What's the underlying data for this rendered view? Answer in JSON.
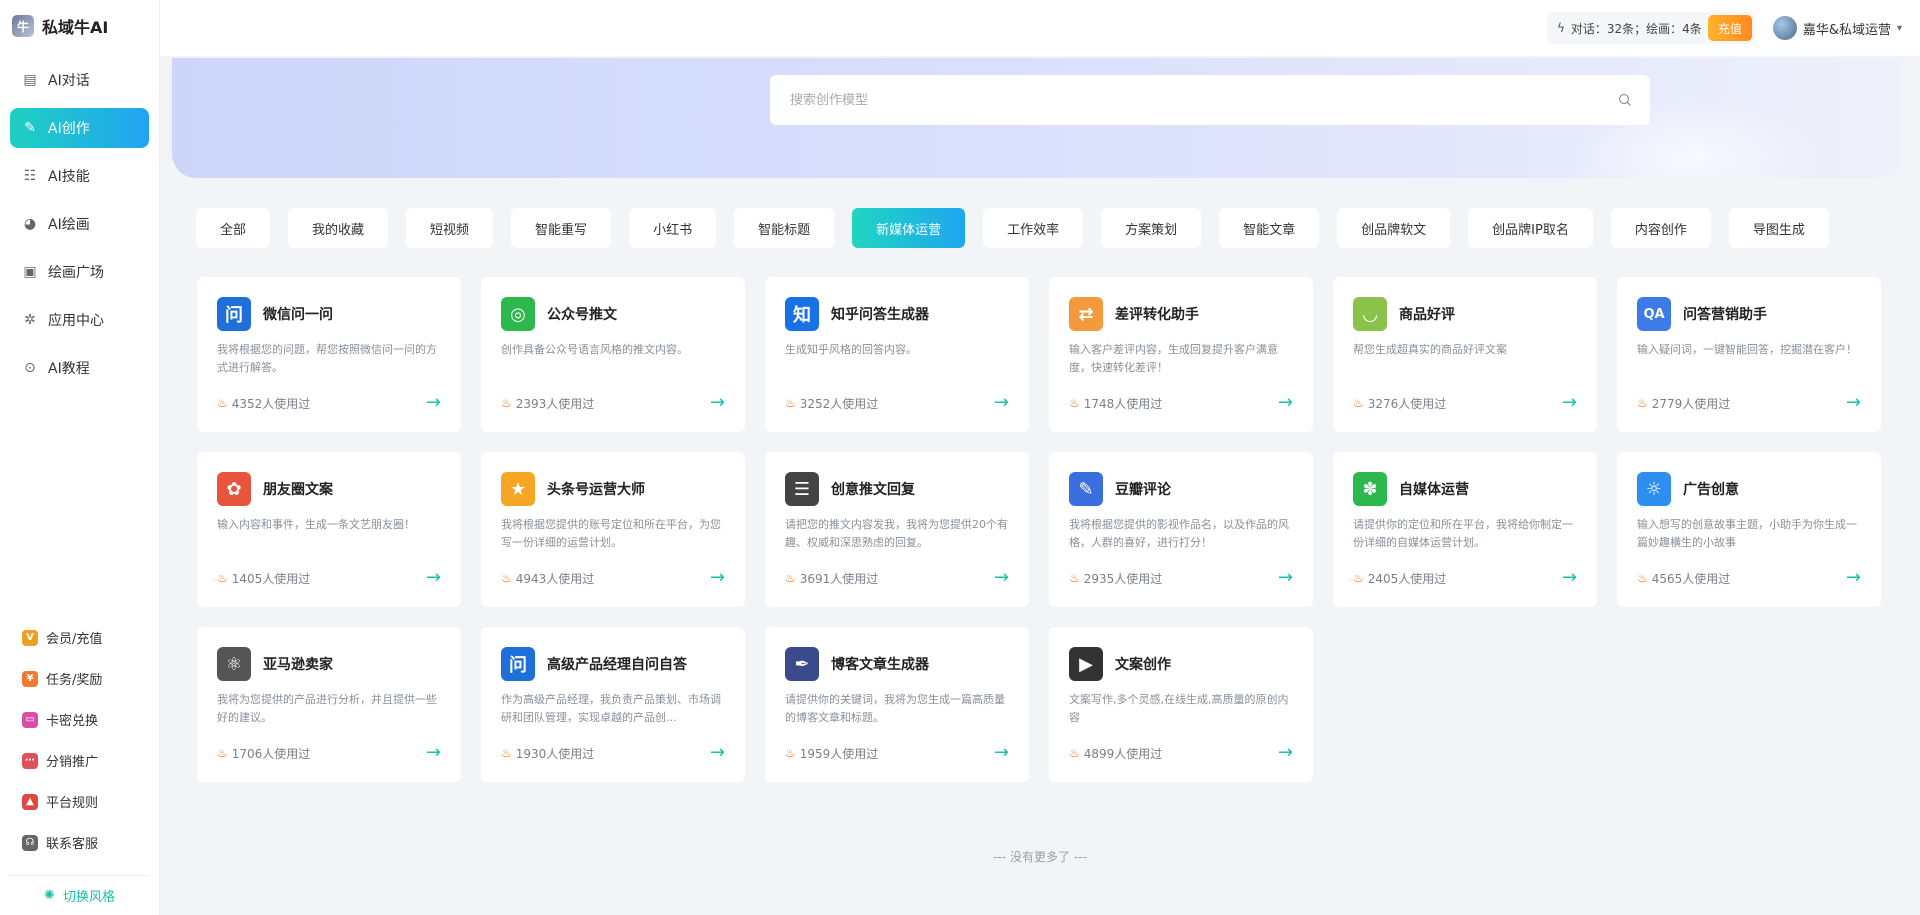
{
  "app": {
    "name": "私域牛AI"
  },
  "sidebar": {
    "items": [
      {
        "label": "AI对话",
        "icon": "chat-icon",
        "active": false
      },
      {
        "label": "AI创作",
        "icon": "pen-icon",
        "active": true
      },
      {
        "label": "AI技能",
        "icon": "skills-icon",
        "active": false
      },
      {
        "label": "AI绘画",
        "icon": "palette-icon",
        "active": false
      },
      {
        "label": "绘画广场",
        "icon": "image-icon",
        "active": false
      },
      {
        "label": "应用中心",
        "icon": "apps-icon",
        "active": false
      },
      {
        "label": "AI教程",
        "icon": "tutorial-icon",
        "active": false
      }
    ],
    "bottom_items": [
      {
        "label": "会员/充值",
        "icon": "vip-icon",
        "color": "#f0a020",
        "glyph": "V"
      },
      {
        "label": "任务/奖励",
        "icon": "task-icon",
        "color": "#f07a30",
        "glyph": "¥"
      },
      {
        "label": "卡密兑换",
        "icon": "card-icon",
        "color": "#d94fa8",
        "glyph": "▭"
      },
      {
        "label": "分销推广",
        "icon": "share-icon",
        "color": "#e0505a",
        "glyph": "⋯"
      },
      {
        "label": "平台规则",
        "icon": "rules-icon",
        "color": "#e04848",
        "glyph": "▲"
      },
      {
        "label": "联系客服",
        "icon": "support-icon",
        "color": "#666666",
        "glyph": "☊"
      }
    ],
    "theme_switch": "切换风格"
  },
  "topbar": {
    "quota_text": "对话：32条；绘画：4条",
    "recharge_label": "充值",
    "username": "嘉华&私域运营"
  },
  "search": {
    "placeholder": "搜索创作模型"
  },
  "tabs": [
    {
      "label": "全部",
      "active": false
    },
    {
      "label": "我的收藏",
      "active": false
    },
    {
      "label": "短视频",
      "active": false
    },
    {
      "label": "智能重写",
      "active": false
    },
    {
      "label": "小红书",
      "active": false
    },
    {
      "label": "智能标题",
      "active": false
    },
    {
      "label": "新媒体运营",
      "active": true
    },
    {
      "label": "工作效率",
      "active": false
    },
    {
      "label": "方案策划",
      "active": false
    },
    {
      "label": "智能文章",
      "active": false
    },
    {
      "label": "创品牌软文",
      "active": false
    },
    {
      "label": "创品牌IP取名",
      "active": false
    },
    {
      "label": "内容创作",
      "active": false
    },
    {
      "label": "导图生成",
      "active": false
    }
  ],
  "cards": [
    {
      "title": "微信问一问",
      "desc": "我将根据您的问题，帮您按照微信问一问的方式进行解答。",
      "usage": "4352人使用过",
      "icon": "wechat-ask-icon",
      "glyph": "问",
      "color": "#1e6fd9"
    },
    {
      "title": "公众号推文",
      "desc": "创作具备公众号语言风格的推文内容。",
      "usage": "2393人使用过",
      "icon": "official-account-icon",
      "glyph": "◎",
      "color": "#2db84d"
    },
    {
      "title": "知乎问答生成器",
      "desc": "生成知乎风格的回答内容。",
      "usage": "3252人使用过",
      "icon": "zhihu-icon",
      "glyph": "知",
      "color": "#1772e6"
    },
    {
      "title": "差评转化助手",
      "desc": "输入客户差评内容，生成回复提升客户满意度，快速转化差评！",
      "usage": "1748人使用过",
      "icon": "exchange-icon",
      "glyph": "⇄",
      "color": "#f59a3c"
    },
    {
      "title": "商品好评",
      "desc": "帮您生成超真实的商品好评文案",
      "usage": "3276人使用过",
      "icon": "shopping-bag-icon",
      "glyph": "◡",
      "color": "#8bc34a"
    },
    {
      "title": "问答营销助手",
      "desc": "输入疑问词，一键智能回答，挖掘潜在客户！",
      "usage": "2779人使用过",
      "icon": "qa-icon",
      "glyph": "QA",
      "color": "#3d7be8"
    },
    {
      "title": "朋友圈文案",
      "desc": "输入内容和事件，生成一条文艺朋友圈！",
      "usage": "1405人使用过",
      "icon": "moments-icon",
      "glyph": "✿",
      "color": "#e8553d"
    },
    {
      "title": "头条号运营大师",
      "desc": "我将根据您提供的账号定位和所在平台，为您写一份详细的运营计划。",
      "usage": "4943人使用过",
      "icon": "star-icon",
      "glyph": "★",
      "color": "#f5a623"
    },
    {
      "title": "创意推文回复",
      "desc": "请把您的推文内容发我，我将为您提供20个有趣、权威和深思熟虑的回复。",
      "usage": "3691人使用过",
      "icon": "message-icon",
      "glyph": "☰",
      "color": "#444444"
    },
    {
      "title": "豆瓣评论",
      "desc": "我将根据您提供的影视作品名，以及作品的风格，人群的喜好，进行打分！",
      "usage": "2935人使用过",
      "icon": "clipboard-icon",
      "glyph": "✎",
      "color": "#3b6fe0"
    },
    {
      "title": "自媒体运营",
      "desc": "请提供你的定位和所在平台，我将给你制定一份详细的自媒体运营计划。",
      "usage": "2405人使用过",
      "icon": "flower-icon",
      "glyph": "✽",
      "color": "#2db84d"
    },
    {
      "title": "广告创意",
      "desc": "输入想写的创意故事主题，小助手为你生成一篇妙趣横生的小故事",
      "usage": "4565人使用过",
      "icon": "lightbulb-icon",
      "glyph": "☼",
      "color": "#2f8ff0"
    },
    {
      "title": "亚马逊卖家",
      "desc": "我将为您提供的产品进行分析，并且提供一些好的建议。",
      "usage": "1706人使用过",
      "icon": "atom-icon",
      "glyph": "⚛",
      "color": "#555555"
    },
    {
      "title": "高级产品经理自问自答",
      "desc": "作为高级产品经理，我负责产品策划、市场调研和团队管理，实现卓越的产品创...",
      "usage": "1930人使用过",
      "icon": "ask-icon",
      "glyph": "问",
      "color": "#1e6fd9"
    },
    {
      "title": "博客文章生成器",
      "desc": "请提供你的关键词，我将为您生成一篇高质量的博客文章和标题。",
      "usage": "1959人使用过",
      "icon": "pen-nib-icon",
      "glyph": "✒",
      "color": "#3a4a8a"
    },
    {
      "title": "文案创作",
      "desc": "文案写作,多个灵感,在线生成,高质量的原创内容",
      "usage": "4899人使用过",
      "icon": "video-icon",
      "glyph": "▶",
      "color": "#333333"
    }
  ],
  "footer": {
    "no_more": "--- 没有更多了 ---"
  }
}
